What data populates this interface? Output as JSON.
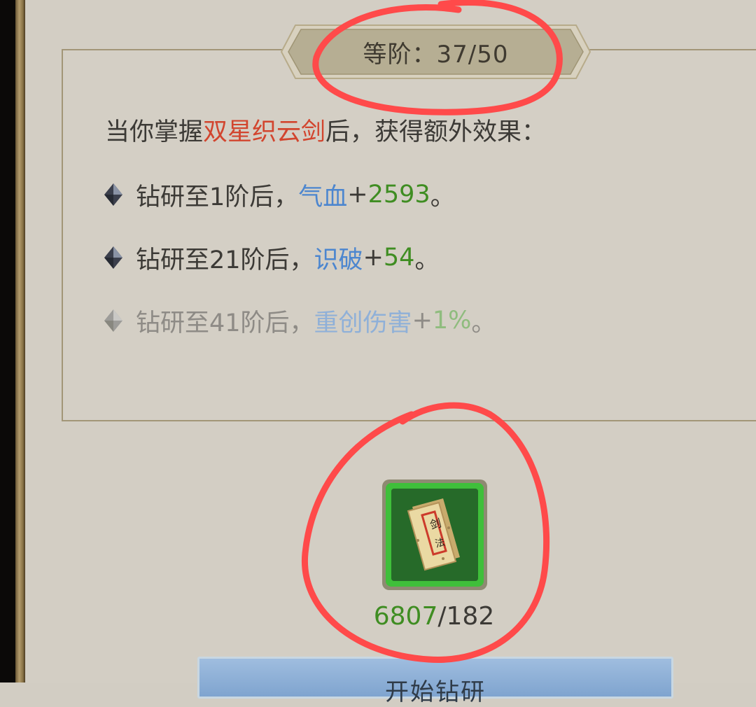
{
  "header": {
    "label": "等阶：37/50"
  },
  "description": {
    "prefix": "当你掌握",
    "skill_name": "双星织云剑",
    "suffix": "后，获得额外效果："
  },
  "bonuses": [
    {
      "condition": "钻研至1阶后，",
      "stat": "气血",
      "plus": " + ",
      "value": "2593",
      "end": "。",
      "unlocked": true
    },
    {
      "condition": "钻研至21阶后，",
      "stat": "识破",
      "plus": " + ",
      "value": "54",
      "end": "。",
      "unlocked": true
    },
    {
      "condition": "钻研至41阶后，",
      "stat": "重创伤害",
      "plus": " + ",
      "value": "1%",
      "end": "。",
      "unlocked": false
    }
  ],
  "item": {
    "icon": "sword-manual-scroll-icon",
    "owned": "6807",
    "separator": "/",
    "required": "182"
  },
  "start_button": {
    "label": "开始钻研"
  },
  "colors": {
    "skill_name": "#d2452e",
    "stat_name": "#4c86cf",
    "stat_value": "#3f8d22",
    "item_frame": "#3fbf3a",
    "annotation": "#ff4a4a"
  }
}
